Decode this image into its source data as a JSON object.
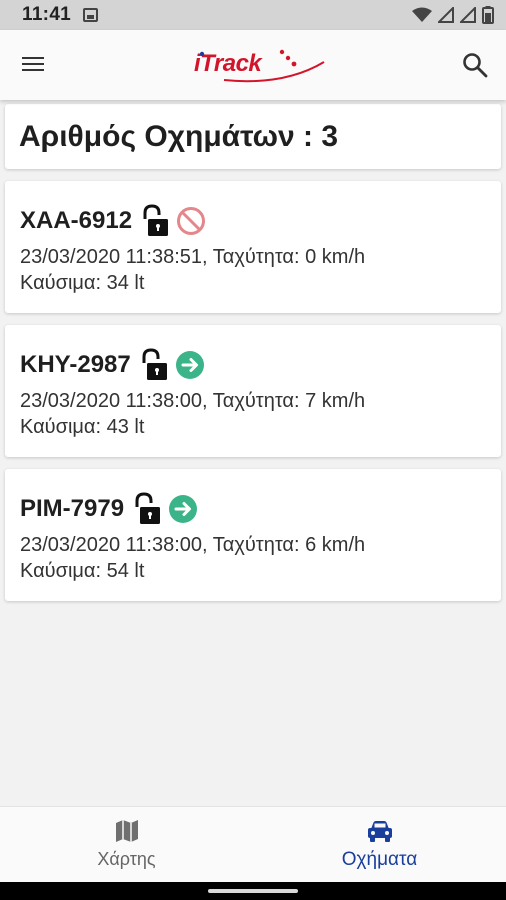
{
  "status_bar": {
    "time": "11:41",
    "icons": [
      "image-icon",
      "wifi-icon",
      "signal-icon",
      "signal-icon",
      "battery-icon"
    ]
  },
  "app_bar": {
    "logo_text": "iTrack",
    "icons": [
      "menu-icon",
      "search-icon"
    ],
    "brand_color": "#d3152c"
  },
  "summary": {
    "title": "Αριθμός Οχημάτων : 3"
  },
  "vehicles": [
    {
      "plate": "XAA-6912",
      "lock_icon": "unlocked-icon",
      "status_icon": "blocked-icon",
      "status_color": "#e4878b",
      "info": "23/03/2020 11:38:51, Ταχύτητα: 0 km/h",
      "fuel": "Καύσιμα: 34 lt"
    },
    {
      "plate": "KHY-2987",
      "lock_icon": "unlocked-icon",
      "status_icon": "arrow-right-icon",
      "status_color": "#3cb48a",
      "info": "23/03/2020 11:38:00, Ταχύτητα: 7 km/h",
      "fuel": "Καύσιμα: 43 lt"
    },
    {
      "plate": "PIM-7979",
      "lock_icon": "unlocked-icon",
      "status_icon": "arrow-right-icon",
      "status_color": "#3cb48a",
      "info": "23/03/2020 11:38:00, Ταχύτητα: 6 km/h",
      "fuel": "Καύσιμα: 54 lt"
    }
  ],
  "bottom_nav": {
    "items": [
      {
        "label": "Χάρτης",
        "icon": "map-icon",
        "active": false
      },
      {
        "label": "Οχήματα",
        "icon": "car-icon",
        "active": true
      }
    ],
    "active_color": "#1a3e9c"
  }
}
